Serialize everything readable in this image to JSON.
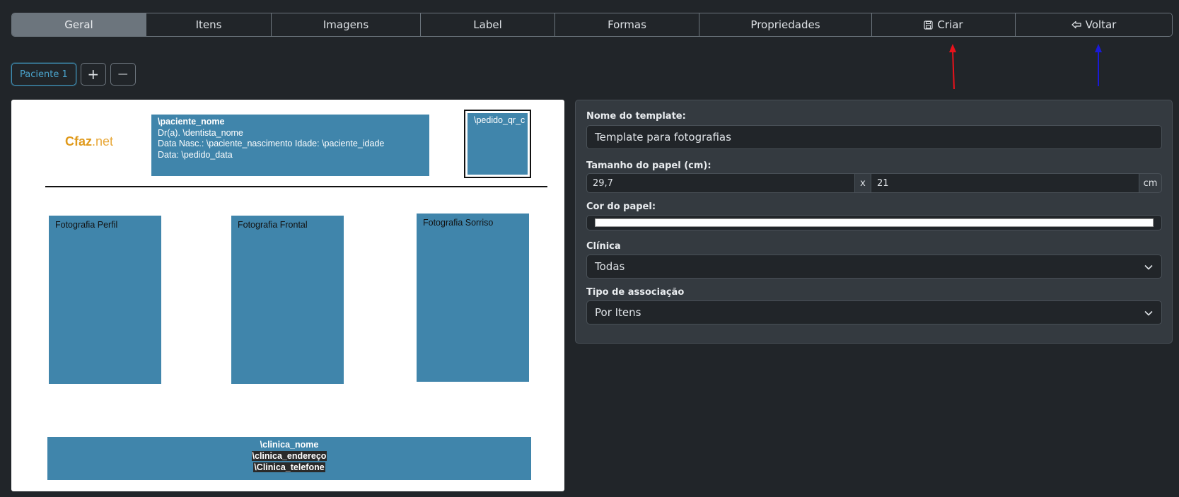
{
  "tabs": {
    "geral": "Geral",
    "itens": "Itens",
    "imagens": "Imagens",
    "label": "Label",
    "formas": "Formas",
    "propriedades": "Propriedades",
    "criar": "Criar",
    "voltar": "Voltar"
  },
  "pages": {
    "current": "Paciente 1",
    "add": "+",
    "remove": "—"
  },
  "canvas": {
    "logo_main": "Cfaz",
    "logo_suffix": ".net",
    "header_lines": [
      "\\paciente_nome",
      "Dr(a). \\dentista_nome",
      "Data Nasc.: \\paciente_nascimento Idade: \\paciente_idade",
      "Data: \\pedido_data"
    ],
    "qr_text": "\\pedido_qr_c",
    "photos": [
      "Fotografia Perfil",
      "Fotografia Frontal",
      "Fotografia Sorriso"
    ],
    "footer_lines": [
      "\\clinica_nome",
      "\\clinica_endereço",
      "\\Clinica_telefone"
    ]
  },
  "form": {
    "template_name_label": "Nome do template:",
    "template_name_value": "Template para fotografias",
    "paper_size_label": "Tamanho do papel (cm):",
    "paper_width": "29,7",
    "paper_x": "x",
    "paper_height": "21",
    "paper_unit": "cm",
    "paper_color_label": "Cor do papel:",
    "paper_color": "#ffffff",
    "clinic_label": "Clínica",
    "clinic_value": "Todas",
    "association_label": "Tipo de associação",
    "association_value": "Por Itens"
  },
  "colors": {
    "background": "#212529",
    "block": "#4085ab",
    "arrow_criar": "#e8121b",
    "arrow_voltar": "#1a1ad6"
  }
}
